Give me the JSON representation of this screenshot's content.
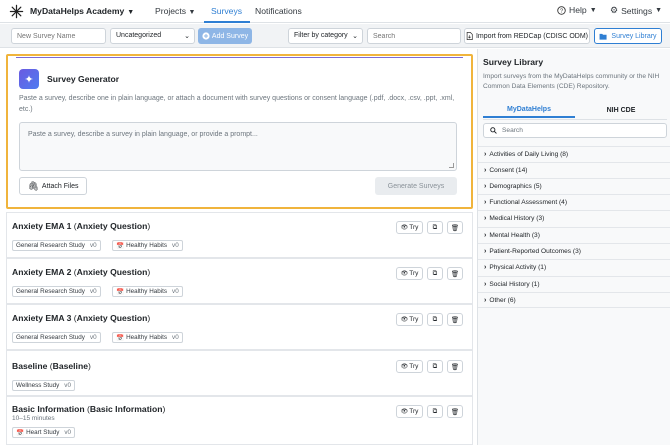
{
  "topnav": {
    "brand": "MyDataHelps Academy",
    "projects": "Projects",
    "surveys": "Surveys",
    "notifications": "Notifications",
    "help": "Help",
    "settings": "Settings"
  },
  "toolbar": {
    "survey_name_placeholder": "New Survey Name",
    "category_value": "Uncategorized",
    "add_survey": "Add Survey",
    "filter_value": "Filter by category",
    "search_placeholder": "Search",
    "import_redcap": "Import from REDCap (CDISC ODM)",
    "survey_library": "Survey Library"
  },
  "generator": {
    "title": "Survey Generator",
    "description": "Paste a survey, describe one in plain language, or attach a document with survey questions or consent language (.pdf, .docx, .csv, .ppt, .xml, etc.)",
    "prompt_placeholder": "Paste a survey, describe a survey in plain language, or provide a prompt...",
    "attach_label": "Attach Files",
    "generate_label": "Generate Surveys"
  },
  "surveys": [
    {
      "name": "Anxiety EMA 1",
      "subtitle": "Anxiety Question",
      "duration": "",
      "tags": [
        {
          "label": "General Research Study",
          "version": "v0",
          "icon": ""
        },
        {
          "label": "Healthy Habits",
          "version": "v0",
          "icon": "calendar-icon"
        }
      ]
    },
    {
      "name": "Anxiety EMA 2",
      "subtitle": "Anxiety Question",
      "duration": "",
      "tags": [
        {
          "label": "General Research Study",
          "version": "v0",
          "icon": ""
        },
        {
          "label": "Healthy Habits",
          "version": "v0",
          "icon": "calendar-icon"
        }
      ]
    },
    {
      "name": "Anxiety EMA 3",
      "subtitle": "Anxiety Question",
      "duration": "",
      "tags": [
        {
          "label": "General Research Study",
          "version": "v0",
          "icon": ""
        },
        {
          "label": "Healthy Habits",
          "version": "v0",
          "icon": "calendar-icon"
        }
      ]
    },
    {
      "name": "Baseline",
      "subtitle": "Baseline",
      "duration": "",
      "tags": [
        {
          "label": "Wellness Study",
          "version": "v0",
          "icon": ""
        }
      ]
    },
    {
      "name": "Basic Information",
      "subtitle": "Basic Information",
      "duration": "10–15 minutes",
      "tags": [
        {
          "label": "Heart Study",
          "version": "v0",
          "icon": "calendar-icon"
        }
      ]
    }
  ],
  "card_actions": {
    "try": "Try"
  },
  "library": {
    "title": "Survey Library",
    "description": "Import surveys from the MyDataHelps community or the NIH Common Data Elements (CDE) Repository.",
    "tabs": [
      "MyDataHelps",
      "NIH CDE"
    ],
    "search_placeholder": "Search",
    "categories": [
      "Activities of Daily Living (8)",
      "Consent (14)",
      "Demographics (5)",
      "Functional Assessment (4)",
      "Medical History (3)",
      "Mental Health (3)",
      "Patient-Reported Outcomes (3)",
      "Physical Activity (1)",
      "Social History (1)",
      "Other (6)"
    ]
  },
  "colors": {
    "accent": "#2f7fd3",
    "highlight_border": "#f0b43c",
    "add_button": "#8eb6e6"
  }
}
